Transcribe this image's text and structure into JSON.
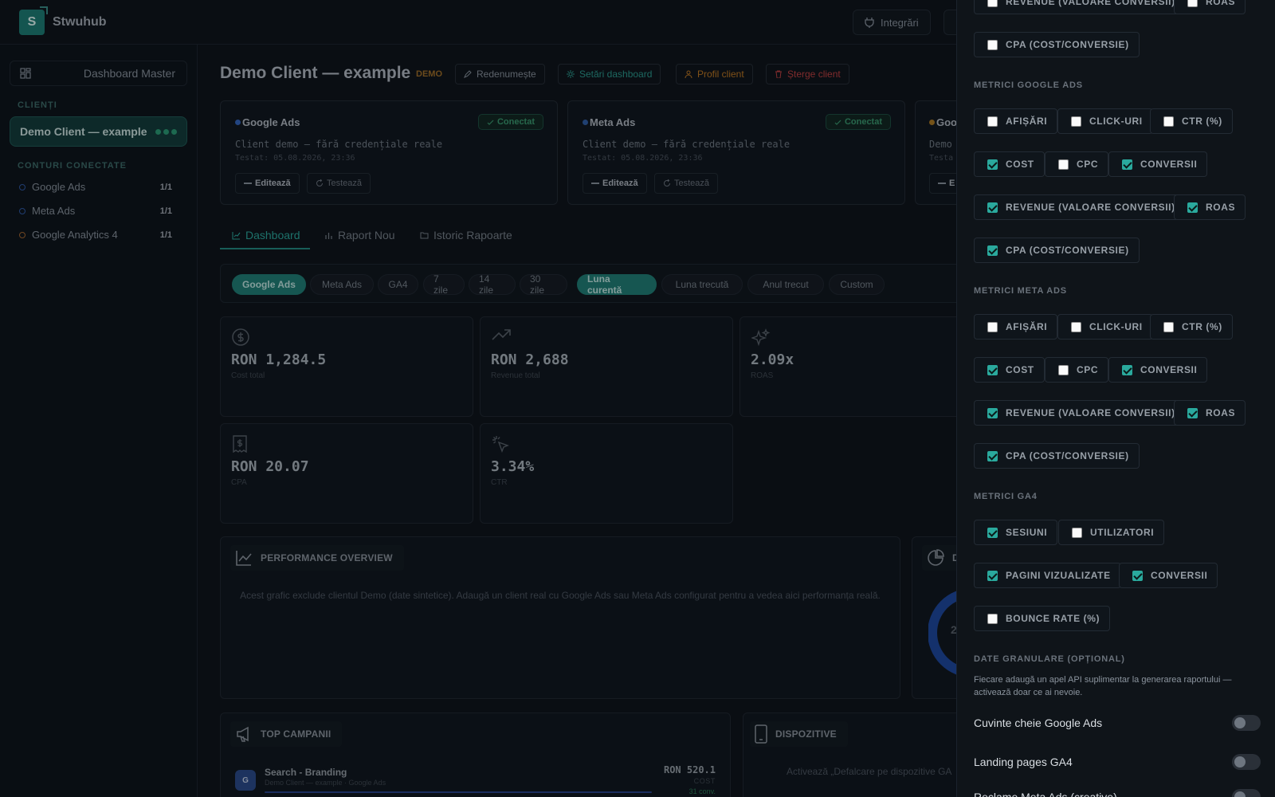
{
  "app": {
    "logo_letter": "S",
    "name": "Stwuhub"
  },
  "topbar": {
    "integrations_label": "Integrări"
  },
  "sidebar": {
    "dashboard_master": "Dashboard Master",
    "clients_label": "CLIENȚI",
    "active_client": "Demo Client — example",
    "connected_label": "CONTURI CONECTATE",
    "accounts": [
      {
        "name": "Google Ads",
        "count": "1/1",
        "color": "#2e5aa8"
      },
      {
        "name": "Meta Ads",
        "count": "1/1",
        "color": "#2e5aa8"
      },
      {
        "name": "Google Analytics 4",
        "count": "1/1",
        "color": "#a8672e"
      }
    ]
  },
  "header": {
    "title": "Demo Client — example",
    "badge": "DEMO",
    "rename": "Redenumește",
    "settings": "Setări dashboard",
    "profile": "Profil client",
    "delete": "Șterge client"
  },
  "accounts_cards": [
    {
      "name": "Google Ads",
      "status": "Conectat",
      "desc": "Client demo — fără credențiale reale",
      "tested": "Testat: 05.08.2026, 23:36",
      "edit": "Editează",
      "test": "Testează"
    },
    {
      "name": "Meta Ads",
      "status": "Conectat",
      "desc": "Client demo — fără credențiale reale",
      "tested": "Testat: 05.08.2026, 23:36",
      "edit": "Editează",
      "test": "Testează"
    },
    {
      "name": "Goo",
      "desc": "Demo c",
      "tested": "Testa",
      "edit": "E"
    }
  ],
  "tabs": [
    "Dashboard",
    "Raport Nou",
    "Istoric Rapoarte"
  ],
  "filters": {
    "platforms": [
      "Google Ads",
      "Meta Ads",
      "GA4"
    ],
    "periods": [
      "7 zile",
      "14 zile",
      "30 zile",
      "Luna curentă",
      "Luna trecută",
      "Anul trecut",
      "Custom"
    ],
    "active_platform": "Google Ads",
    "active_period": "Luna curentă"
  },
  "kpis": [
    {
      "value": "RON 1,284.5",
      "label": "Cost total",
      "icon": "dollar-circle-icon"
    },
    {
      "value": "RON 2,688",
      "label": "Revenue total",
      "icon": "trending-up-icon"
    },
    {
      "value": "2.09x",
      "label": "ROAS",
      "icon": "sparkles-icon"
    },
    {
      "value": "RON 20.07",
      "label": "CPA",
      "icon": "receipt-icon"
    },
    {
      "value": "3.34%",
      "label": "CTR",
      "icon": "pointer-click-icon"
    }
  ],
  "performance": {
    "title": "PERFORMANCE OVERVIEW",
    "note": "Acest grafic exclude clientul Demo (date sintetice). Adaugă un client real cu Google Ads sau Meta Ads configurat pentru a vedea aici performanța reală."
  },
  "distribution_title": "D",
  "donut_label": "2",
  "top_campaigns": {
    "title": "TOP CAMPANII",
    "rows": [
      {
        "badge": "G",
        "name": "Search - Branding",
        "sub": "Demo Client — example · Google Ads",
        "value": "RON 520.1",
        "metric": "COST",
        "conv": "31 conv."
      }
    ]
  },
  "devices": {
    "title": "DISPOZITIVE",
    "note": "Activează „Defalcare pe dispozitive GA"
  },
  "drawer": {
    "top_row1": [
      {
        "label": "REVENUE (VALOARE CONVERSII)",
        "checked": false
      },
      {
        "label": "ROAS",
        "checked": false
      }
    ],
    "top_row2": [
      {
        "label": "CPA (COST/CONVERSIE)",
        "checked": false
      }
    ],
    "google_title": "METRICI GOOGLE ADS",
    "meta_title": "METRICI META ADS",
    "ga4_title": "METRICI GA4",
    "ads_metrics": [
      [
        {
          "label": "AFIȘĂRI",
          "checked": false
        },
        {
          "label": "CLICK-URI",
          "checked": false
        },
        {
          "label": "CTR (%)",
          "checked": false
        }
      ],
      [
        {
          "label": "COST",
          "checked": true
        },
        {
          "label": "CPC",
          "checked": false
        },
        {
          "label": "CONVERSII",
          "checked": true
        }
      ],
      [
        {
          "label": "REVENUE (VALOARE CONVERSII)",
          "checked": true
        },
        {
          "label": "ROAS",
          "checked": true
        }
      ],
      [
        {
          "label": "CPA (COST/CONVERSIE)",
          "checked": true
        }
      ]
    ],
    "ga4_metrics": [
      [
        {
          "label": "SESIUNI",
          "checked": true
        },
        {
          "label": "UTILIZATORI",
          "checked": false
        }
      ],
      [
        {
          "label": "PAGINI VIZUALIZATE",
          "checked": true
        },
        {
          "label": "CONVERSII",
          "checked": true
        }
      ],
      [
        {
          "label": "BOUNCE RATE (%)",
          "checked": false
        }
      ]
    ],
    "granular_title": "DATE GRANULARE (OPȚIONAL)",
    "granular_desc": "Fiecare adaugă un apel API suplimentar la generarea raportului — activează doar ce ai nevoie.",
    "toggles": [
      {
        "label": "Cuvinte cheie Google Ads",
        "on": false
      },
      {
        "label": "Landing pages GA4",
        "on": false
      },
      {
        "label": "Reclame Meta Ads (creative)",
        "on": false
      }
    ]
  },
  "colors": {
    "accent": "#1f8077",
    "warning": "#c2791f",
    "danger": "#c33f3f"
  }
}
